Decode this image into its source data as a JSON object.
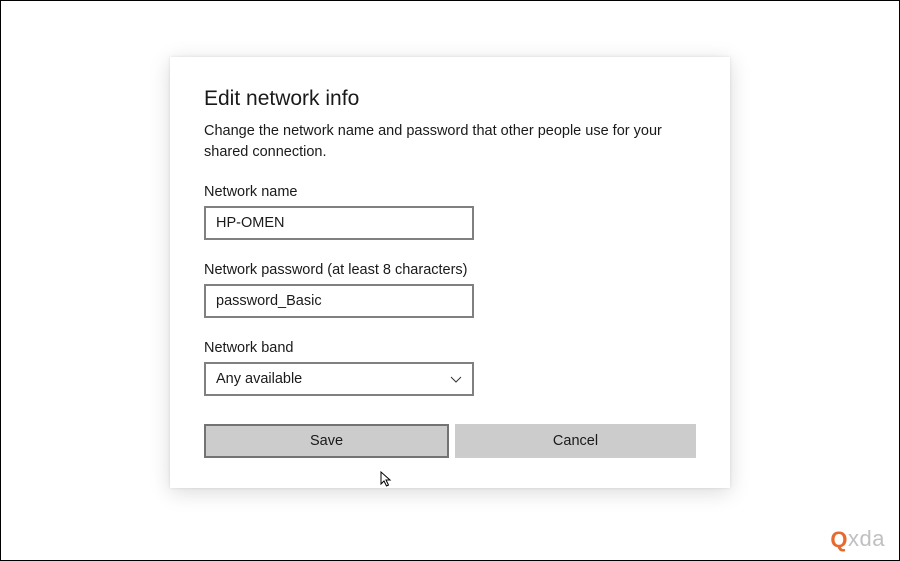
{
  "dialog": {
    "title": "Edit network info",
    "description": "Change the network name and password that other people use for your shared connection."
  },
  "fields": {
    "name_label": "Network name",
    "name_value": "HP-OMEN",
    "password_label": "Network password (at least 8 characters)",
    "password_value": "password_Basic",
    "band_label": "Network band",
    "band_value": "Any available"
  },
  "buttons": {
    "save": "Save",
    "cancel": "Cancel"
  },
  "watermark": {
    "prefix": "Q",
    "suffix": "xda"
  }
}
